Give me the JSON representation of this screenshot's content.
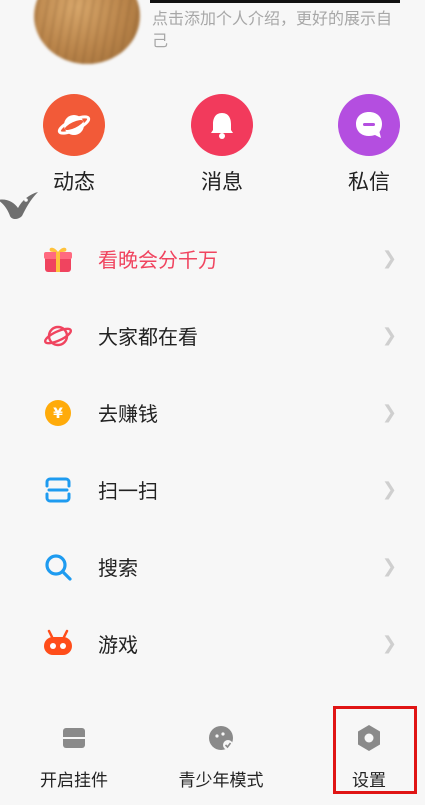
{
  "profile": {
    "bio": "点击添加个人介绍，更好的展示自己"
  },
  "quick_actions": [
    {
      "label": "动态",
      "icon": "planet-icon",
      "color": "#f25a38"
    },
    {
      "label": "消息",
      "icon": "bell-icon",
      "color": "#f23a5c"
    },
    {
      "label": "私信",
      "icon": "chat-icon",
      "color": "#b44ee0"
    }
  ],
  "menu": [
    {
      "label": "看晚会分千万",
      "icon": "gift-icon",
      "highlighted": true
    },
    {
      "label": "大家都在看",
      "icon": "planet-outline-icon"
    },
    {
      "label": "去赚钱",
      "icon": "coin-icon"
    },
    {
      "label": "扫一扫",
      "icon": "scan-icon"
    },
    {
      "label": "搜索",
      "icon": "search-icon"
    },
    {
      "label": "游戏",
      "icon": "game-icon"
    }
  ],
  "bottom_bar": [
    {
      "label": "开启挂件",
      "icon": "widget-icon"
    },
    {
      "label": "青少年模式",
      "icon": "teen-mode-icon"
    },
    {
      "label": "设置",
      "icon": "settings-icon",
      "selected": true
    }
  ],
  "colors": {
    "highlight_text": "#f0445f",
    "selection_frame": "#e01515"
  }
}
